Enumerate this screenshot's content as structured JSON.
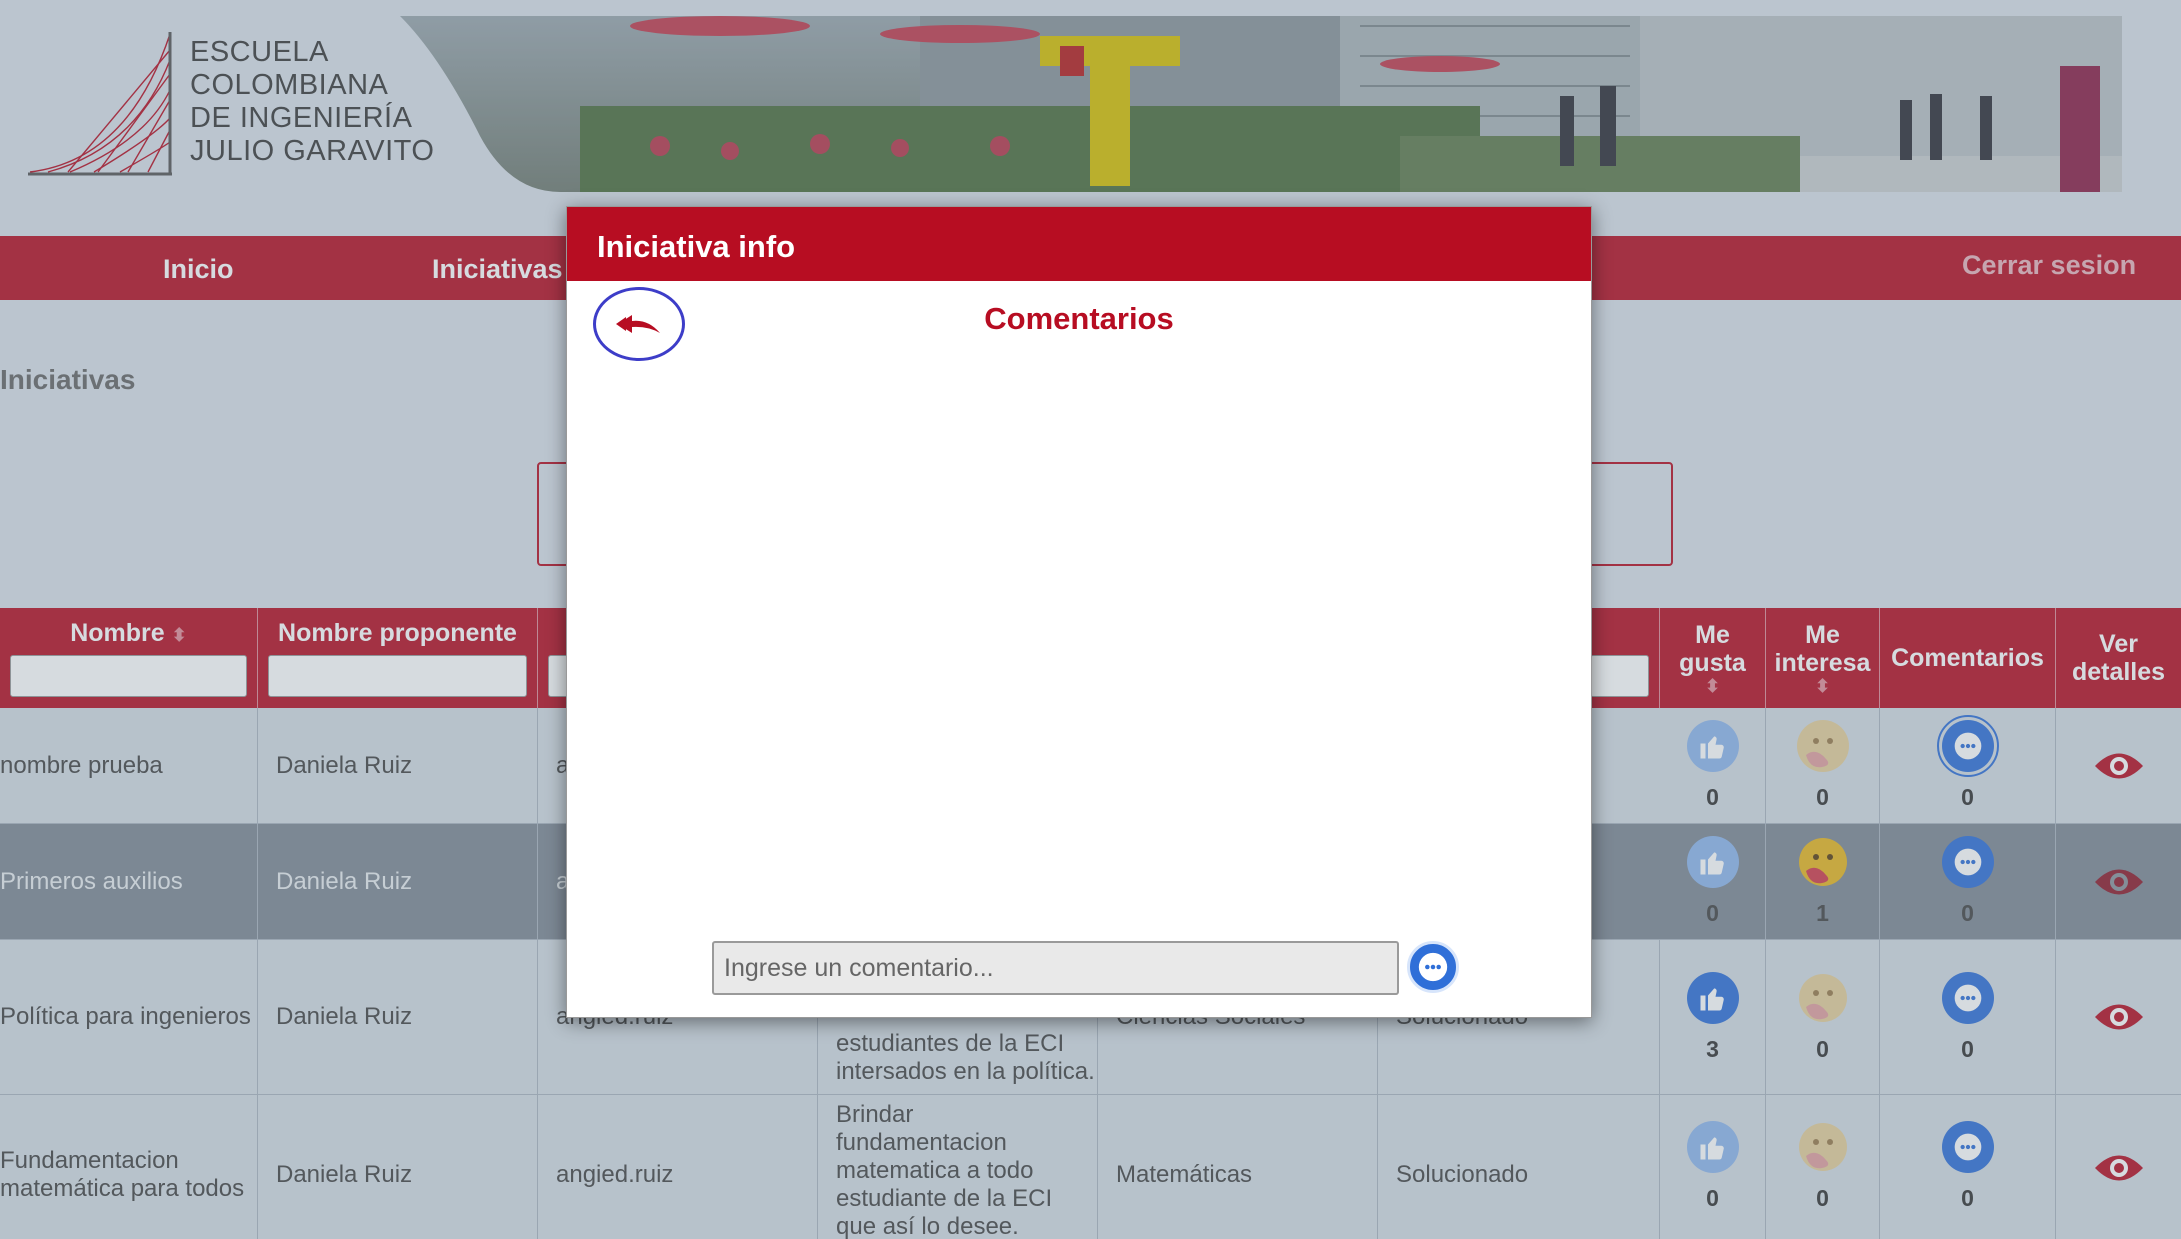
{
  "header": {
    "logo_lines": [
      "ESCUELA",
      "COLOMBIANA",
      "DE INGENIERÍA",
      "JULIO GARAVITO"
    ]
  },
  "nav": {
    "items": [
      "Inicio",
      "Iniciativas"
    ],
    "logout": "Cerrar sesion"
  },
  "page": {
    "section_title": "Iniciativas"
  },
  "table": {
    "headers": {
      "nombre": "Nombre",
      "proponente": "Nombre proponente",
      "me_gusta": "Me gusta",
      "me_interesa": "Me interesa",
      "comentarios": "Comentarios",
      "ver_detalles": "Ver detalles"
    },
    "rows": [
      {
        "nombre": "nombre prueba",
        "proponente": "Daniela Ruiz",
        "usuario": "a",
        "descripcion": "",
        "area": "",
        "estado": "",
        "likes": "0",
        "interests": "0",
        "comments": "0"
      },
      {
        "nombre": "Primeros auxilios",
        "proponente": "Daniela Ruiz",
        "usuario": "a",
        "descripcion": "",
        "area": "",
        "estado": "",
        "likes": "0",
        "interests": "1",
        "comments": "0"
      },
      {
        "nombre": "Política para ingenieros",
        "proponente": "Daniela Ruiz",
        "usuario": "angied.ruiz",
        "descripcion": "estudiantes de la ECI intersados en la política.",
        "area": "Ciencias Sociales",
        "estado": "Solucionado",
        "likes": "3",
        "interests": "0",
        "comments": "0"
      },
      {
        "nombre": "Fundamentacion matemática para todos",
        "proponente": "Daniela Ruiz",
        "usuario": "angied.ruiz",
        "descripcion": "Brindar fundamentacion matematica a todo estudiante de la ECI que así lo desee.",
        "area": "Matemáticas",
        "estado": "Solucionado",
        "likes": "0",
        "interests": "0",
        "comments": "0"
      }
    ]
  },
  "modal": {
    "title": "Iniciativa info",
    "heading": "Comentarios",
    "input_placeholder": "Ingrese un comentario...",
    "input_value": ""
  },
  "colors": {
    "brand_red": "#b70d22",
    "like_blue": "#2f6fd8",
    "back_ring": "#3d3dc8"
  },
  "icons": {
    "back": "double-arrow-left-icon",
    "send": "chat-bubble-icon",
    "like": "thumbs-up-icon",
    "interest": "care-emoji-icon",
    "comments": "chat-bubble-icon",
    "details": "eye-icon"
  }
}
